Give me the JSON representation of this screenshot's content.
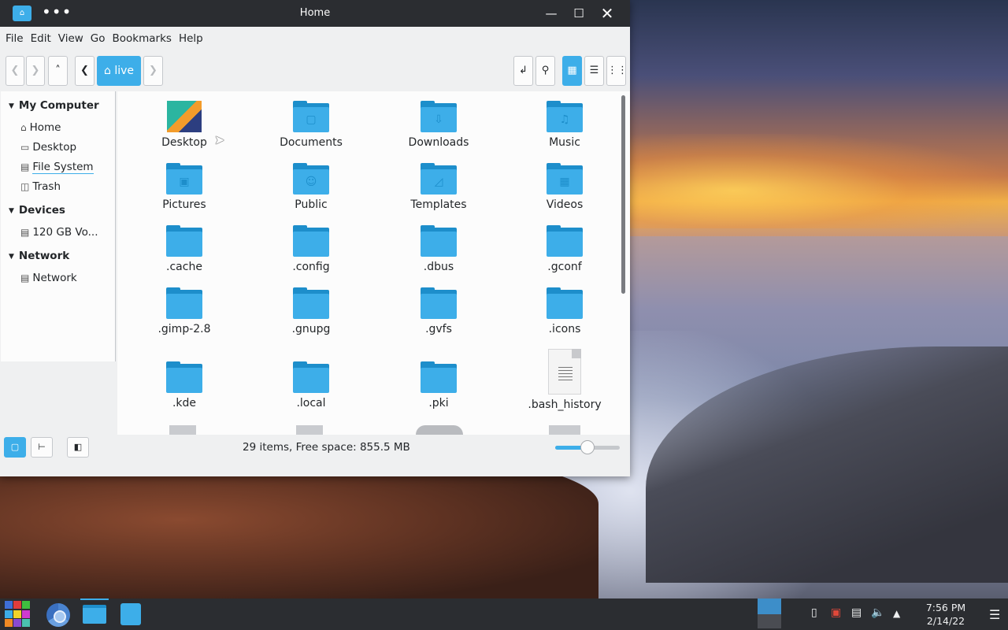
{
  "window": {
    "title": "Home",
    "menu": [
      "File",
      "Edit",
      "View",
      "Go",
      "Bookmarks",
      "Help"
    ],
    "breadcrumb_current": "live"
  },
  "sidebar": {
    "sections": [
      {
        "title": "My Computer",
        "items": [
          {
            "label": "Home",
            "icon": "home-icon"
          },
          {
            "label": "Desktop",
            "icon": "desktop-icon"
          },
          {
            "label": "File System",
            "icon": "drive-icon"
          },
          {
            "label": "Trash",
            "icon": "trash-icon"
          }
        ]
      },
      {
        "title": "Devices",
        "items": [
          {
            "label": "120 GB Vo...",
            "icon": "drive-icon"
          }
        ]
      },
      {
        "title": "Network",
        "items": [
          {
            "label": "Network",
            "icon": "network-icon"
          }
        ]
      }
    ]
  },
  "files": [
    {
      "name": "Desktop",
      "type": "desktop"
    },
    {
      "name": "Documents",
      "type": "folder",
      "emblem": "doc"
    },
    {
      "name": "Downloads",
      "type": "folder",
      "emblem": "download"
    },
    {
      "name": "Music",
      "type": "folder",
      "emblem": "music"
    },
    {
      "name": "Pictures",
      "type": "folder",
      "emblem": "picture"
    },
    {
      "name": "Public",
      "type": "folder",
      "emblem": "people"
    },
    {
      "name": "Templates",
      "type": "folder",
      "emblem": "template"
    },
    {
      "name": "Videos",
      "type": "folder",
      "emblem": "video"
    },
    {
      "name": ".cache",
      "type": "folder"
    },
    {
      "name": ".config",
      "type": "folder"
    },
    {
      "name": ".dbus",
      "type": "folder"
    },
    {
      "name": ".gconf",
      "type": "folder"
    },
    {
      "name": ".gimp-2.8",
      "type": "folder"
    },
    {
      "name": ".gnupg",
      "type": "folder"
    },
    {
      "name": ".gvfs",
      "type": "folder"
    },
    {
      "name": ".icons",
      "type": "folder"
    },
    {
      "name": ".kde",
      "type": "folder"
    },
    {
      "name": ".local",
      "type": "folder"
    },
    {
      "name": ".pki",
      "type": "folder"
    },
    {
      "name": ".bash_history",
      "type": "text"
    }
  ],
  "status": {
    "text": "29 items, Free space: 855.5 MB",
    "zoom_fraction": 0.5
  },
  "taskbar": {
    "time": "7:56 PM",
    "date": "2/14/22"
  },
  "colors": {
    "accent": "#3daee9",
    "titlebar": "#2b2d31",
    "folder": "#3daee9"
  }
}
